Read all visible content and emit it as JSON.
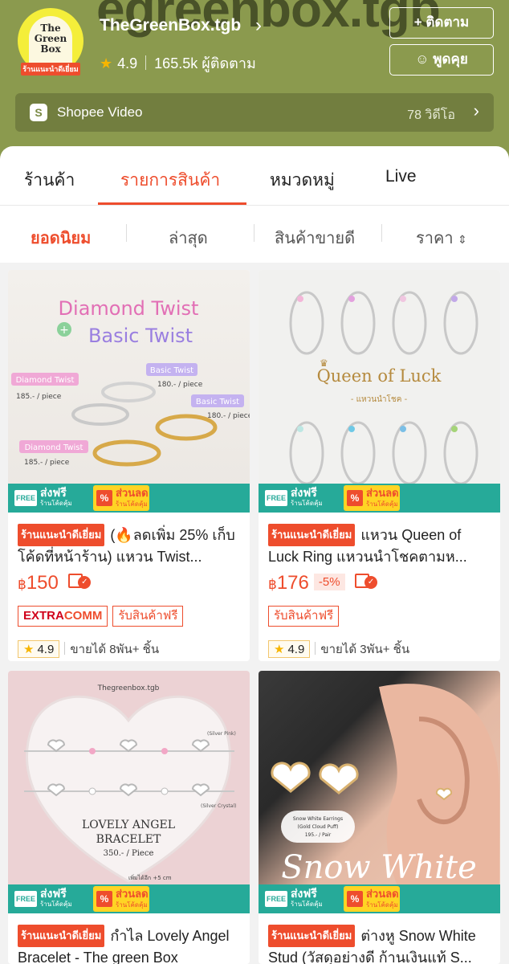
{
  "shop": {
    "bg_name": "egreenbox.tgb",
    "logo_line1": "The",
    "logo_line2": "Green",
    "logo_line3": "Box",
    "badge": "ร้านแนะนำดีเยี่ยม",
    "name": "TheGreenBox.tgb",
    "rating": "4.9",
    "followers": "165.5k ผู้ติดตาม",
    "follow_label": "+ ติดตาม",
    "chat_label": "พูดคุย",
    "video_label": "Shopee Video",
    "video_count": "78 วิดีโอ"
  },
  "tabs": [
    {
      "label": "ร้านค้า"
    },
    {
      "label": "รายการสินค้า"
    },
    {
      "label": "หมวดหมู่"
    },
    {
      "label": "Live"
    }
  ],
  "sort": [
    {
      "label": "ยอดนิยม"
    },
    {
      "label": "ล่าสุด"
    },
    {
      "label": "สินค้าขายดี"
    },
    {
      "label": "ราคา"
    }
  ],
  "promo": {
    "free_label": "FREE",
    "ship_label": "ส่งฟรี",
    "ship_sub": "ร้านโค้ดคุ้ม",
    "disc_label": "ส่วนลด",
    "disc_sub": "ร้านโค้ดคุ้ม",
    "pct_symbol": "%"
  },
  "products": [
    {
      "image": {
        "title1": "Diamond Twist",
        "plus": "+",
        "title2": "Basic Twist",
        "labels": [
          "Diamond Twist",
          "Basic Twist",
          "Basic Twist",
          "Diamond Twist"
        ],
        "prices": [
          "185.- / piece",
          "180.- / piece",
          "180.- / piece",
          "185.- / piece"
        ]
      },
      "mall_badge": "ร้านแนะนำดีเยี่ยม",
      "title": "(🔥ลดเพิ่ม 25% เก็บโค้ดที่หน้าร้าน) แหวน Twist...",
      "price_currency": "฿",
      "price": "150",
      "discount": "",
      "extra_1": "EXTRA",
      "extra_2": "COMM",
      "free_item": "รับสินค้าฟรี",
      "rating": "4.9",
      "sold": "ขายได้ 8พัน+ ชิ้น"
    },
    {
      "image": {
        "title": "Queen of Luck",
        "subtitle": "- แหวนนำโชค -"
      },
      "mall_badge": "ร้านแนะนำดีเยี่ยม",
      "title": "แหวน Queen of Luck Ring แหวนนำโชคตามห...",
      "price_currency": "฿",
      "price": "176",
      "discount": "-5%",
      "free_item": "รับสินค้าฟรี",
      "rating": "4.9",
      "sold": "ขายได้ 3พัน+ ชิ้น"
    },
    {
      "image": {
        "brand": "Thegreenbox.tgb",
        "title1": "LOVELY ANGEL",
        "title2": "BRACELET",
        "price": "350.- / Piece",
        "label_silver_pink": "(Silver Pink)",
        "label_silver_crystal": "(Silver Crystal)",
        "extend": "เพิ่มได้อีก +5 cm"
      },
      "mall_badge": "ร้านแนะนำดีเยี่ยม",
      "title": "กำไล Lovely Angel Bracelet - The green Box"
    },
    {
      "image": {
        "title": "Snow White",
        "tag_line1": "Snow White Earrings",
        "tag_line2": "(Gold Cloud Puff)",
        "tag_line3": "195.- / Pair"
      },
      "mall_badge": "ร้านแนะนำดีเยี่ยม",
      "title": "ต่างหู Snow White Stud (วัสดุอย่างดี ก้านเงินแท้ S..."
    }
  ],
  "colors": {
    "header_bg": "#8b9a4e",
    "accent": "#ee4d2d",
    "promo_green": "#26aa99",
    "promo_yellow": "#ffd424",
    "star": "#f7b500"
  }
}
